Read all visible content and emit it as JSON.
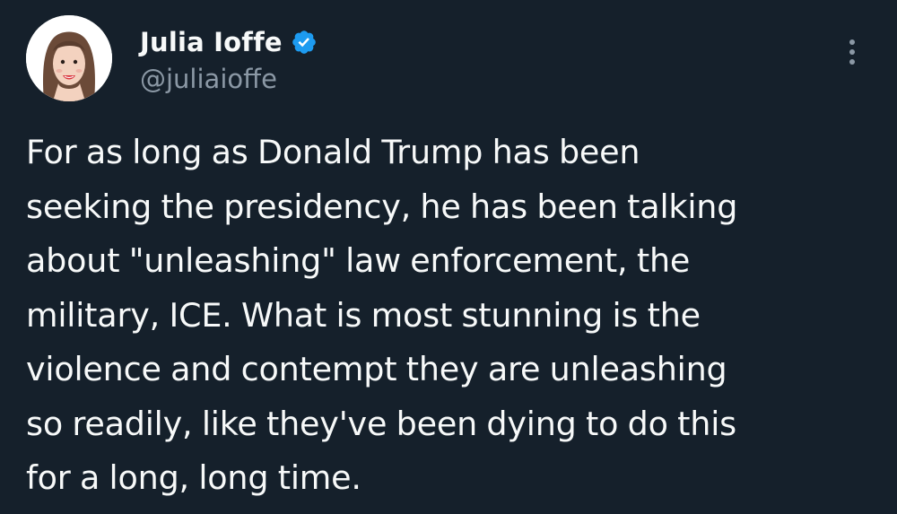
{
  "author": {
    "display_name": "Julia Ioffe",
    "handle": "@juliaioffe",
    "verified": true,
    "avatar_icon": "profile-avatar-illustration"
  },
  "icons": {
    "verified": "verified-badge-icon",
    "more": "more-options-icon"
  },
  "tweet": {
    "lines": [
      "For as long as Donald Trump has been",
      "seeking the presidency, he has been talking",
      "about \"unleashing\" law enforcement, the",
      "military, ICE. What is most stunning is the",
      "violence and contempt they are unleashing",
      "so readily, like they've been dying to do this",
      "for a long, long time."
    ]
  },
  "colors": {
    "background": "#15202b",
    "text_primary": "#f7f9f9",
    "text_secondary": "#8b98a5",
    "verified_blue": "#1d9bf0"
  }
}
